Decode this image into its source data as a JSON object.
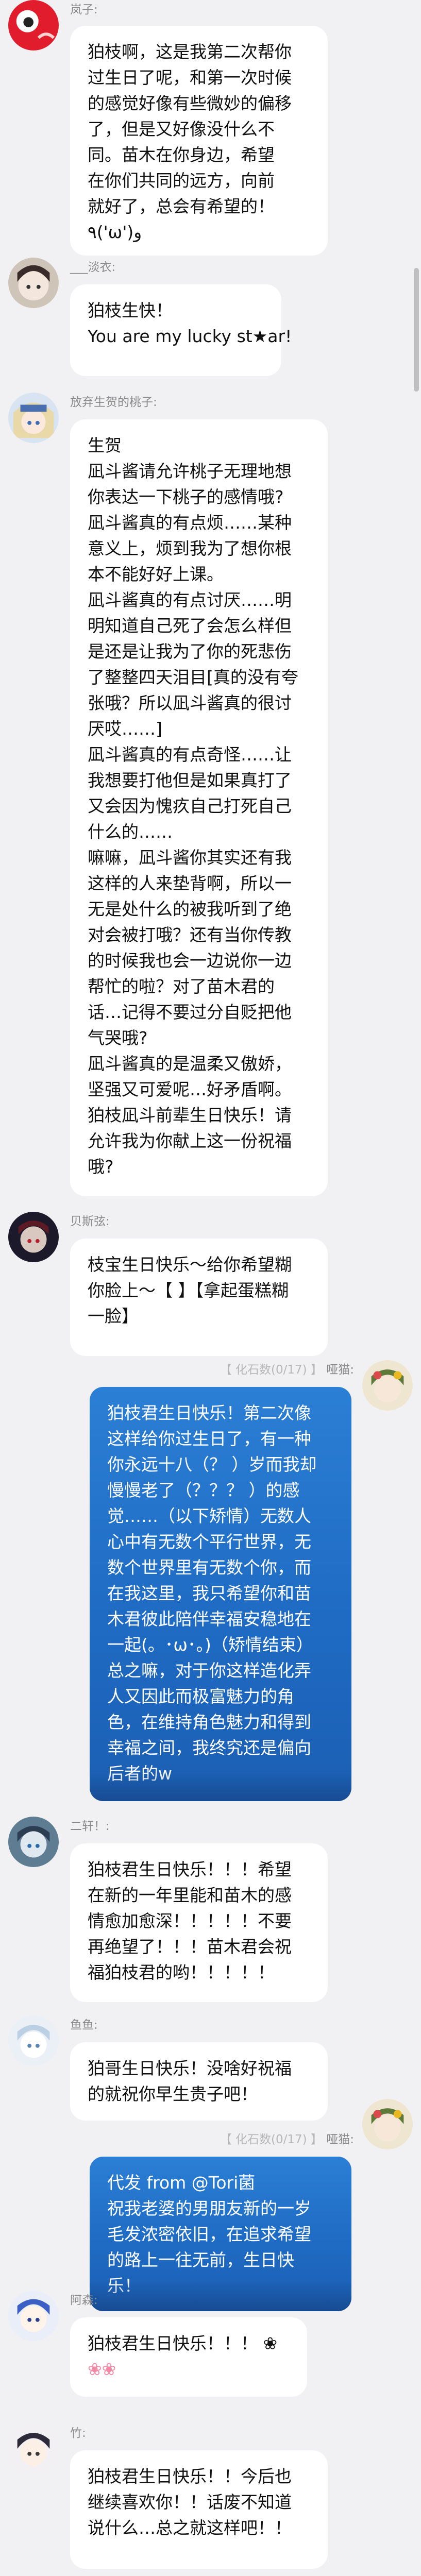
{
  "messages": [
    {
      "name": "岚子:",
      "lines": [
        "狛枝啊，这是我第二次帮你",
        "过生日了呢，和第一次时候",
        "的感觉好像有些微妙的偏移",
        "了，但是又好像没什么不",
        "同。苗木在你身边，希望",
        "在你们共同的远方，向前",
        "就好了，总会有希望的！",
        "٩('ω')و"
      ]
    },
    {
      "name": "___淡衣:",
      "lines": [
        "狛枝生快！",
        "You are my lucky st★ar!"
      ]
    },
    {
      "name": "放弃生贺的桃子:",
      "lines": [
        "生贺",
        "凪斗酱请允许桃子无理地想",
        "你表达一下桃子的感情哦?",
        "凪斗酱真的有点烦……某种",
        "意义上，烦到我为了想你根",
        "本不能好好上课。",
        "凪斗酱真的有点讨厌……明",
        "明知道自己死了会怎么样但",
        "是还是让我为了你的死悲伤",
        "了整整四天泪目[真的没有夸",
        "张哦？所以凪斗酱真的很讨",
        "厌哎……]",
        "凪斗酱真的有点奇怪……让",
        "我想要打他但是如果真打了",
        "又会因为愧疚自己打死自己",
        "什么的……",
        "嘛嘛，凪斗酱你其实还有我",
        "这样的人来垫背啊，所以一",
        "无是处什么的被我听到了绝",
        "对会被打哦？还有当你传教",
        "的时候我也会一边说你一边",
        "帮忙的啦？对了苗木君的",
        "话…记得不要过分自贬把他",
        "气哭哦?",
        "凪斗酱真的是温柔又傲娇，",
        "坚强又可爱呢…好矛盾啊。",
        "狛枝凪斗前辈生日快乐！请",
        "允许我为你献上这一份祝福",
        "哦?"
      ]
    },
    {
      "name": "贝斯弦:",
      "lines": [
        "枝宝生日快乐～给你希望糊",
        "你脸上～【 】【拿起蛋糕糊",
        "一脸】"
      ]
    },
    {
      "name": "哑猫:",
      "tag": "【 化石数(0/17) 】",
      "lines": [
        "狛枝君生日快乐！第二次像",
        "这样给你过生日了，有一种",
        "你永远十八（？ ）岁而我却",
        "慢慢老了（？？？ ）的感",
        "觉……（以下矫情）无数人",
        "心中有无数个平行世界，无",
        "数个世界里有无数个你，而",
        "在我这里，我只希望你和苗",
        "木君彼此陪伴幸福安稳地在",
        "一起(。･ω･。)（矫情结束）",
        "总之嘛，对于你这样造化弄",
        "人又因此而极富魅力的角",
        "色，在维持角色魅力和得到",
        "幸福之间，我终究还是偏向",
        "后者的w"
      ]
    },
    {
      "name": "二轩！:",
      "lines": [
        "狛枝君生日快乐！！！希望",
        "在新的一年里能和苗木的感",
        "情愈加愈深！！！！！不要",
        "再绝望了！！！苗木君会祝",
        "福狛枝君的哟！！！！！"
      ]
    },
    {
      "name": "鱼鱼:",
      "lines": [
        "狛哥生日快乐！没啥好祝福",
        "的就祝你早生贵子吧！"
      ]
    },
    {
      "name": "哑猫:",
      "tag": "【 化石数(0/17) 】",
      "lines": [
        "代发 from @Tori菌",
        "祝我老婆的男朋友新的一岁",
        "毛发浓密依旧，在追求希望",
        "的路上一往无前，生日快",
        "乐！"
      ]
    },
    {
      "name": "阿森:",
      "lines": [
        "狛枝君生日快乐！！！ ❀",
        "❀❀"
      ]
    },
    {
      "name": "竹:",
      "lines": [
        "狛枝君生日快乐！！今后也",
        "继续喜欢你！！话废不知道",
        "说什么…总之就这样吧！！"
      ]
    }
  ],
  "colors": {
    "background": "#f1f1f3",
    "bubble": "#ffffff",
    "bubble_blue": "#1f6bc4",
    "name_text": "#8a8a8a"
  }
}
